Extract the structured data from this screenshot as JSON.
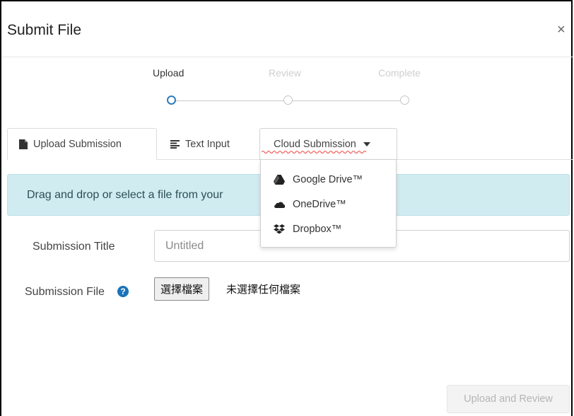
{
  "dialog": {
    "title": "Submit File",
    "close_label": "×"
  },
  "stepper": {
    "steps": [
      {
        "label": "Upload",
        "state": "active"
      },
      {
        "label": "Review",
        "state": "inactive"
      },
      {
        "label": "Complete",
        "state": "inactive"
      }
    ],
    "active_color": "#2f7dbd"
  },
  "tabs": {
    "upload": {
      "label": "Upload Submission",
      "icon": "file-icon"
    },
    "text": {
      "label": "Text Input",
      "icon": "align-left-icon"
    },
    "cloud": {
      "label": "Cloud Submission",
      "icon": "caret-down-icon"
    }
  },
  "cloud_menu": {
    "items": [
      {
        "label": "Google Drive™",
        "icon": "google-drive-icon"
      },
      {
        "label": "OneDrive™",
        "icon": "onedrive-icon"
      },
      {
        "label": "Dropbox™",
        "icon": "dropbox-icon"
      }
    ]
  },
  "alert": {
    "text": "Drag and drop or select a file from your",
    "background": "#d0ecf0"
  },
  "form": {
    "title_label": "Submission Title",
    "title_placeholder": "Untitled",
    "title_value": "",
    "file_label": "Submission File",
    "help_icon": "question-circle-icon",
    "choose_file_label": "選擇檔案",
    "file_status": "未選擇任何檔案"
  },
  "footer": {
    "submit_label": "Upload and Review"
  }
}
